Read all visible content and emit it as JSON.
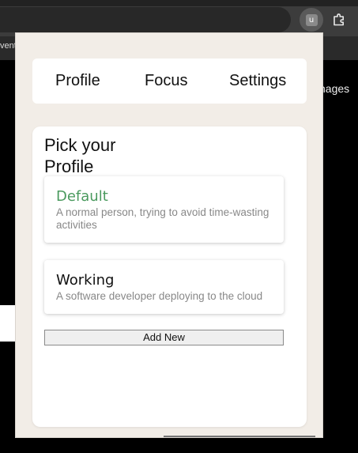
{
  "browser": {
    "extension_letter": "u",
    "tab_left_text": "vent",
    "page_side_text": "nages"
  },
  "nav": {
    "tabs": [
      {
        "label": "Profile"
      },
      {
        "label": "Focus"
      },
      {
        "label": "Settings"
      }
    ]
  },
  "main": {
    "title": "Pick your Profile",
    "profiles": [
      {
        "name": "Default",
        "description": "A normal person, trying to avoid time-wasting activities",
        "selected": true
      },
      {
        "name": "Working",
        "description": "A software developer deploying to the cloud",
        "selected": false
      }
    ],
    "add_new_label": "Add New"
  },
  "colors": {
    "selected_profile": "#4a9a5e",
    "popup_background": "#f2ede7"
  }
}
